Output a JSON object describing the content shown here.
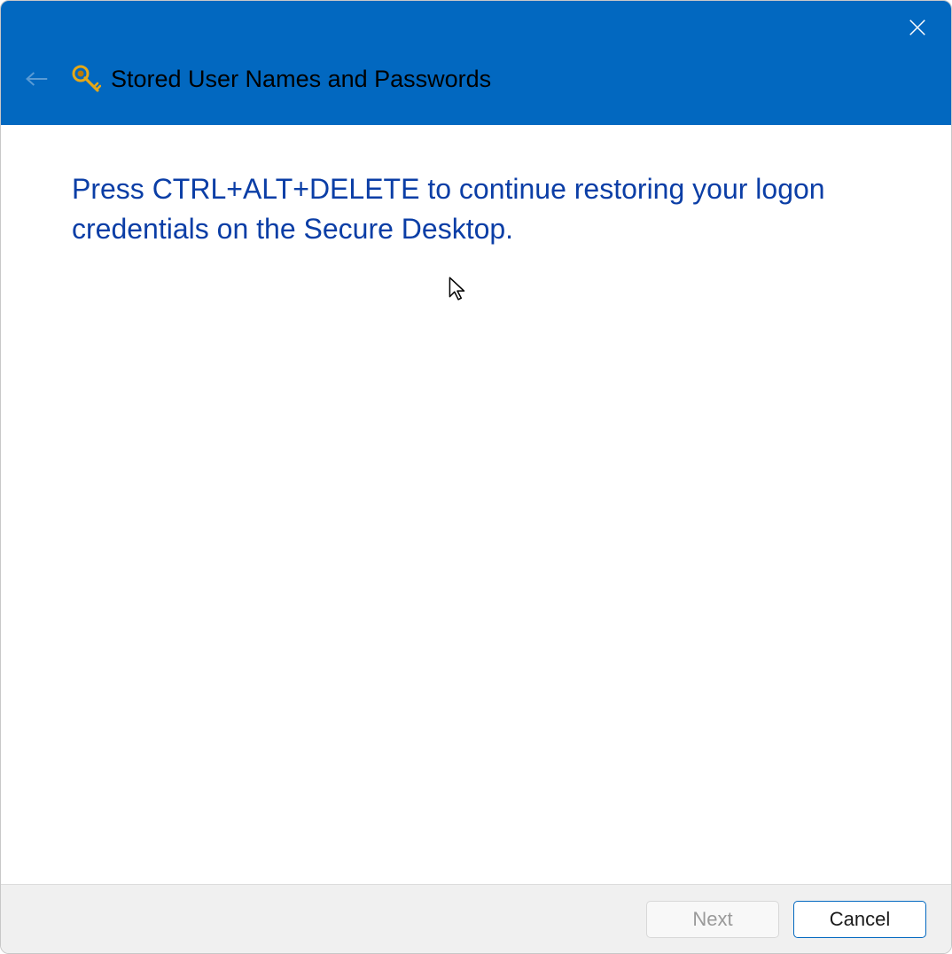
{
  "header": {
    "title": "Stored User Names and Passwords"
  },
  "content": {
    "instruction": "Press CTRL+ALT+DELETE to continue restoring your logon credentials on the Secure Desktop."
  },
  "footer": {
    "next_label": "Next",
    "cancel_label": "Cancel",
    "next_enabled": false
  },
  "colors": {
    "header_bg": "#0268c0",
    "instruction_text": "#0b3ea6",
    "footer_bg": "#f0f0f0"
  }
}
